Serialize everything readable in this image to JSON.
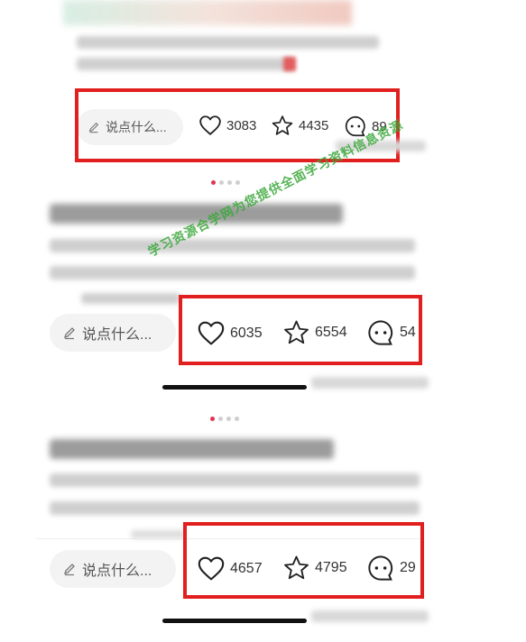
{
  "watermark": {
    "text": "学习资源合学网为您提供全面学习资料信息资源"
  },
  "comment_placeholder": "说点什么...",
  "posts": [
    {
      "likes": "3083",
      "favorites": "4435",
      "comments": "89"
    },
    {
      "likes": "6035",
      "favorites": "6554",
      "comments": "54"
    },
    {
      "likes": "4657",
      "favorites": "4795",
      "comments": "29"
    }
  ],
  "colors": {
    "highlight_box": "#e21f1f",
    "active_dot": "#e33355",
    "watermark": "#3aa83a"
  }
}
